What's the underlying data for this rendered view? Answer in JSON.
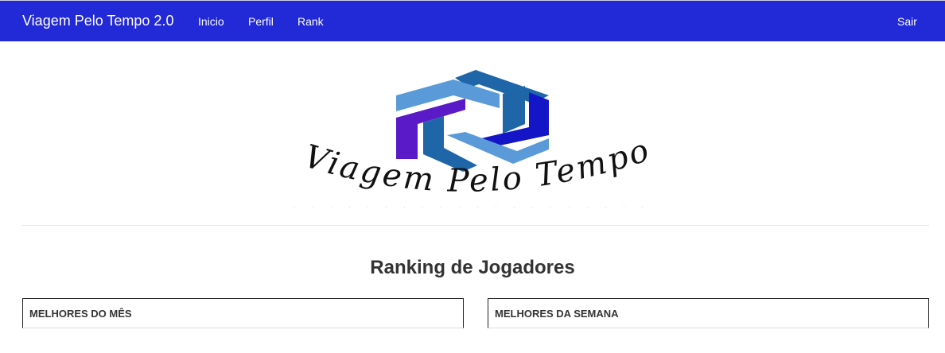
{
  "navbar": {
    "brand": "Viagem Pelo Tempo 2.0",
    "links": {
      "inicio": "Inicio",
      "perfil": "Perfil",
      "rank": "Rank",
      "sair": "Sair"
    },
    "background": "#2229d6"
  },
  "logo": {
    "text": "Viagem Pelo Tempo",
    "colors": {
      "dark_blue": "#1e66a8",
      "light_blue": "#5a9ad8",
      "royal_blue": "#1515c8",
      "purple": "#5a1ac8"
    }
  },
  "main": {
    "title": "Ranking de Jogadores",
    "panels": {
      "month": "MELHORES DO MÊS",
      "week": "MELHORES DA SEMANA"
    }
  }
}
